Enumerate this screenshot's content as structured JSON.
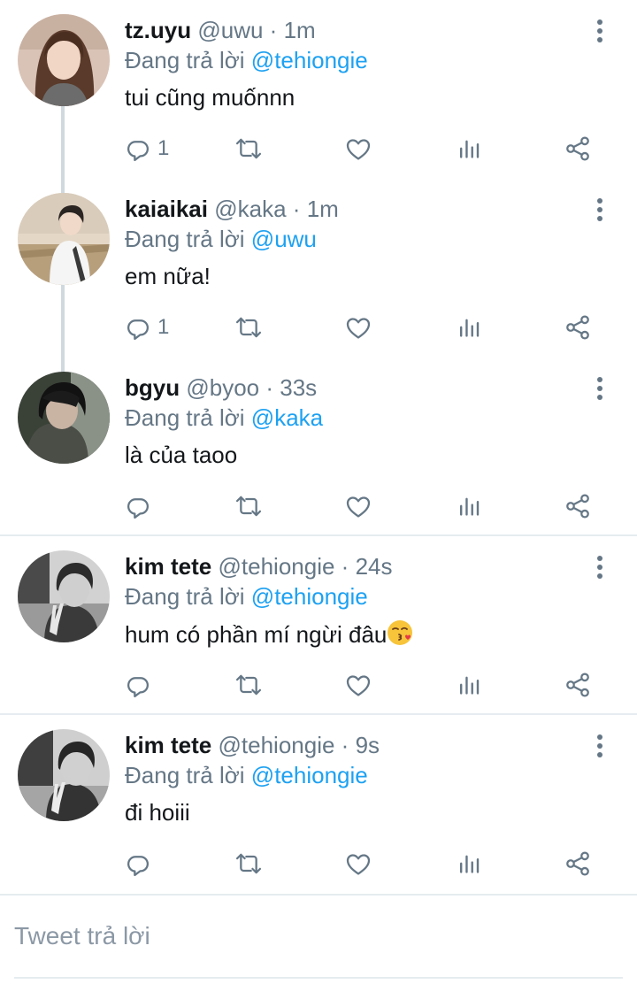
{
  "tweets": [
    {
      "name": "tz.uyu",
      "handle": "@uwu",
      "sep": "·",
      "time": "1m",
      "replying_prefix": "Đang trả lời",
      "replying_to": "@tehiongie",
      "text": "tui cũng muốnnn",
      "reply_count": "1",
      "avatar": "avatar-woman-long-hair"
    },
    {
      "name": "kaiaikai",
      "handle": "@kaka",
      "sep": "·",
      "time": "1m",
      "replying_prefix": "Đang trả lời",
      "replying_to": "@uwu",
      "text": "em nữa!",
      "reply_count": "1",
      "avatar": "avatar-person-white-hoodie"
    },
    {
      "name": "bgyu",
      "handle": "@byoo",
      "sep": "·",
      "time": "33s",
      "replying_prefix": "Đang trả lời",
      "replying_to": "@kaka",
      "text": "là của taoo",
      "reply_count": "",
      "avatar": "avatar-dark-hair"
    },
    {
      "name": "kim tete",
      "handle": "@tehiongie",
      "sep": "·",
      "time": "24s",
      "replying_prefix": "Đang trả lời",
      "replying_to": "@tehiongie",
      "text": "hum có phần mí ngừi đâu",
      "emoji": "😘",
      "reply_count": "",
      "avatar": "avatar-bw-peace-sign"
    },
    {
      "name": "kim tete",
      "handle": "@tehiongie",
      "sep": "·",
      "time": "9s",
      "replying_prefix": "Đang trả lời",
      "replying_to": "@tehiongie",
      "text": "đi hoiii",
      "reply_count": "",
      "avatar": "avatar-bw-peace-sign"
    }
  ],
  "reply_box": {
    "placeholder": "Tweet trả lời"
  },
  "icons": [
    "reply-icon",
    "retweet-icon",
    "like-icon",
    "stats-icon",
    "share-icon",
    "more-icon"
  ],
  "colors": {
    "mention": "#1da1f2",
    "secondary_text": "#657786",
    "thread_line": "#cfd9de",
    "divider": "#e6ecf0"
  }
}
